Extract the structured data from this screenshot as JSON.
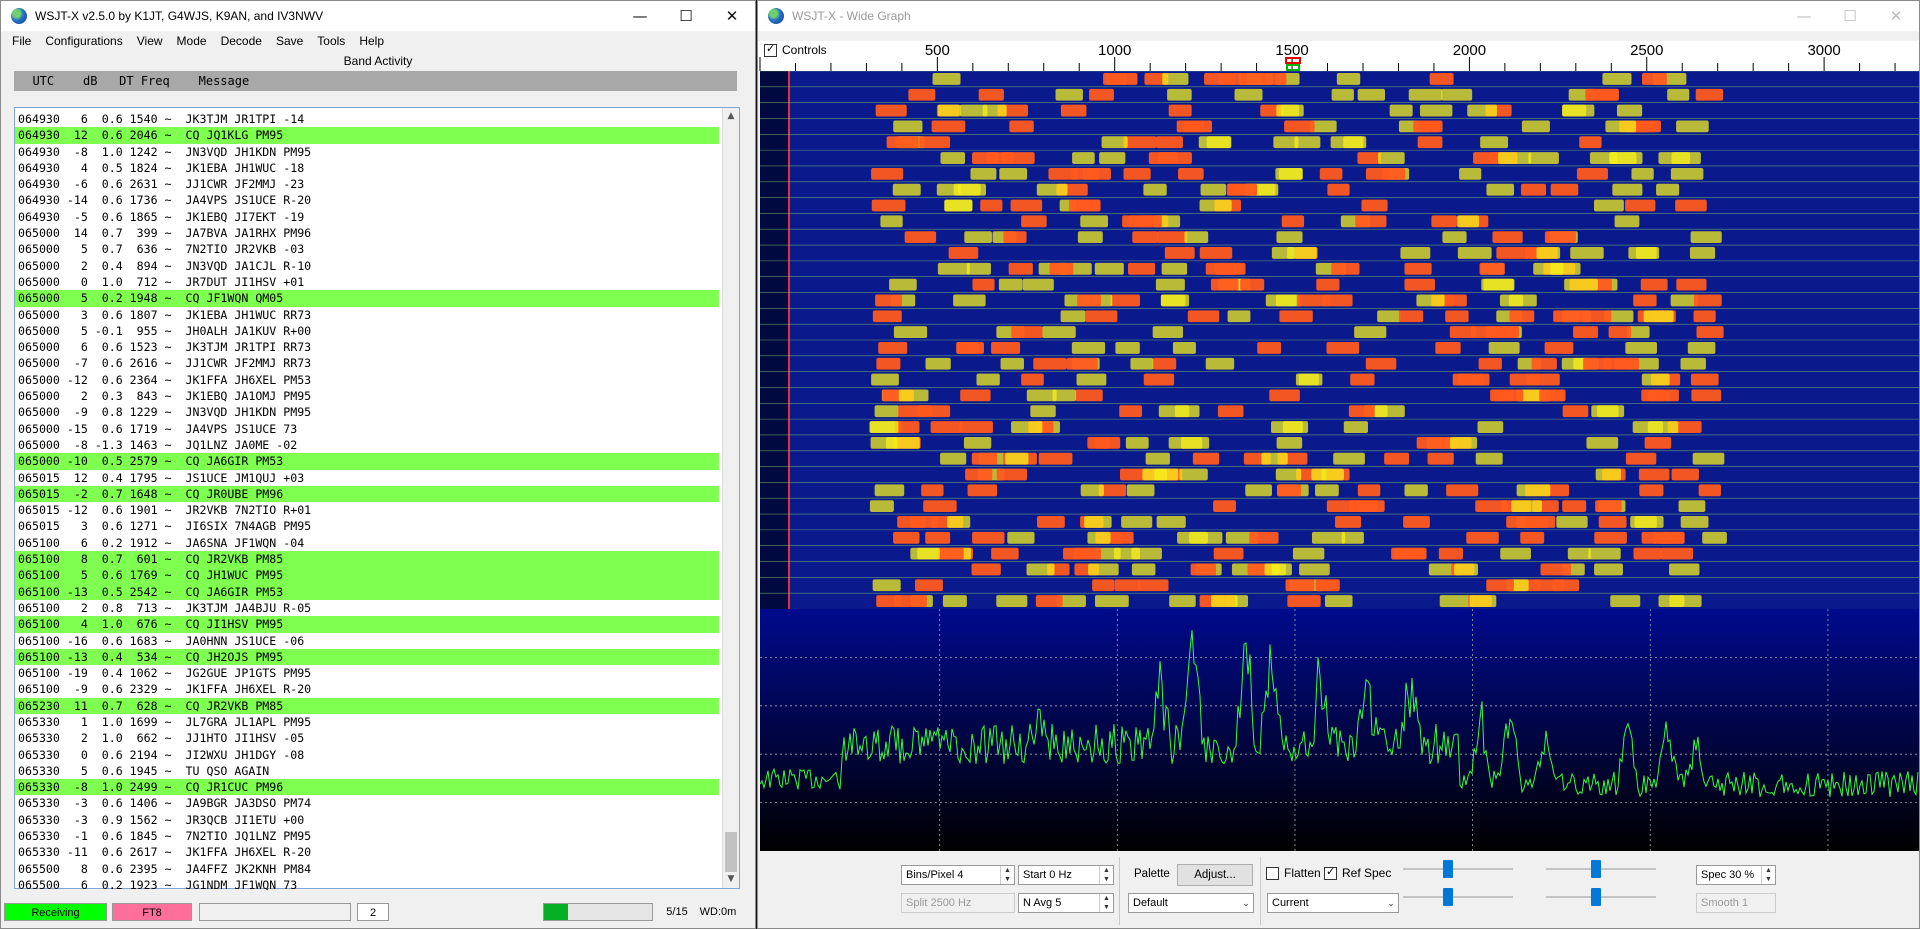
{
  "main_window": {
    "title": "WSJT-X   v2.5.0   by K1JT, G4WJS, K9AN, and IV3NWV",
    "menu": [
      "File",
      "Configurations",
      "View",
      "Mode",
      "Decode",
      "Save",
      "Tools",
      "Help"
    ],
    "band_activity_title": "Band Activity",
    "columns_header": "  UTC    dB   DT Freq    Message",
    "rows": [
      {
        "text": "064930   6  0.6 1540 ~  JK3TJM JR1TPI -14",
        "cq": false
      },
      {
        "text": "064930  12  0.6 2046 ~  CQ JQ1KLG PM95",
        "cq": true
      },
      {
        "text": "064930  -8  1.0 1242 ~  JN3VQD JH1KDN PM95",
        "cq": false
      },
      {
        "text": "064930   4  0.5 1824 ~  JK1EBA JH1WUC -18",
        "cq": false
      },
      {
        "text": "064930  -6  0.6 2631 ~  JJ1CWR JF2MMJ -23",
        "cq": false
      },
      {
        "text": "064930 -14  0.6 1736 ~  JA4VPS JS1UCE R-20",
        "cq": false
      },
      {
        "text": "064930  -5  0.6 1865 ~  JK1EBQ JI7EKT -19",
        "cq": false
      },
      {
        "text": "065000  14  0.7  399 ~  JA7BVA JA1RHX PM96",
        "cq": false
      },
      {
        "text": "065000   5  0.7  636 ~  7N2TIO JR2VKB -03",
        "cq": false
      },
      {
        "text": "065000   2  0.4  894 ~  JN3VQD JA1CJL R-10",
        "cq": false
      },
      {
        "text": "065000   0  1.0  712 ~  JR7DUT JI1HSV +01",
        "cq": false
      },
      {
        "text": "065000   5  0.2 1948 ~  CQ JF1WQN QM05",
        "cq": true
      },
      {
        "text": "065000   3  0.6 1807 ~  JK1EBA JH1WUC RR73",
        "cq": false
      },
      {
        "text": "065000   5 -0.1  955 ~  JH0ALH JA1KUV R+00",
        "cq": false
      },
      {
        "text": "065000   6  0.6 1523 ~  JK3TJM JR1TPI RR73",
        "cq": false
      },
      {
        "text": "065000  -7  0.6 2616 ~  JJ1CWR JF2MMJ RR73",
        "cq": false
      },
      {
        "text": "065000 -12  0.6 2364 ~  JK1FFA JH6XEL PM53",
        "cq": false
      },
      {
        "text": "065000   2  0.3  843 ~  JK1EBQ JA1OMJ PM95",
        "cq": false
      },
      {
        "text": "065000  -9  0.8 1229 ~  JN3VQD JH1KDN PM95",
        "cq": false
      },
      {
        "text": "065000 -15  0.6 1719 ~  JA4VPS JS1UCE 73",
        "cq": false
      },
      {
        "text": "065000  -8 -1.3 1463 ~  JQ1LNZ JA0ME -02",
        "cq": false
      },
      {
        "text": "065000 -10  0.5 2579 ~  CQ JA6GIR PM53",
        "cq": true
      },
      {
        "text": "065015  12  0.4 1795 ~  JS1UCE JM1QUJ +03",
        "cq": false
      },
      {
        "text": "065015  -2  0.7 1648 ~  CQ JR0UBE PM96",
        "cq": true
      },
      {
        "text": "065015 -12  0.6 1901 ~  JR2VKB 7N2TIO R+01",
        "cq": false
      },
      {
        "text": "065015   3  0.6 1271 ~  JI6SIX 7N4AGB PM95",
        "cq": false
      },
      {
        "text": "065100   6  0.2 1912 ~  JA6SNA JF1WQN -04",
        "cq": false
      },
      {
        "text": "065100   8  0.7  601 ~  CQ JR2VKB PM85",
        "cq": true
      },
      {
        "text": "065100   5  0.6 1769 ~  CQ JH1WUC PM95",
        "cq": true
      },
      {
        "text": "065100 -13  0.5 2542 ~  CQ JA6GIR PM53",
        "cq": true
      },
      {
        "text": "065100   2  0.8  713 ~  JK3TJM JA4BJU R-05",
        "cq": false
      },
      {
        "text": "065100   4  1.0  676 ~  CQ JI1HSV PM95",
        "cq": true
      },
      {
        "text": "065100 -16  0.6 1683 ~  JA0HNN JS1UCE -06",
        "cq": false
      },
      {
        "text": "065100 -13  0.4  534 ~  CQ JH2OJS PM95",
        "cq": true
      },
      {
        "text": "065100 -19  0.4 1062 ~  JG2GUE JP1GTS PM95",
        "cq": false
      },
      {
        "text": "065100  -9  0.6 2329 ~  JK1FFA JH6XEL R-20",
        "cq": false
      },
      {
        "text": "065230  11  0.7  628 ~  CQ JR2VKB PM85",
        "cq": true
      },
      {
        "text": "065330   1  1.0 1699 ~  JL7GRA JL1APL PM95",
        "cq": false
      },
      {
        "text": "065330   2  1.0  662 ~  JJ1HTO JI1HSV -05",
        "cq": false
      },
      {
        "text": "065330   0  0.6 2194 ~  JI2WXU JH1DGY -08",
        "cq": false
      },
      {
        "text": "065330   5  0.6 1945 ~  TU QSO AGAIN",
        "cq": false
      },
      {
        "text": "065330  -8  1.0 2499 ~  CQ JR1CUC PM96",
        "cq": true
      },
      {
        "text": "065330  -3  0.6 1406 ~  JA9BGR JA3DSO PM74",
        "cq": false
      },
      {
        "text": "065330  -3  0.9 1562 ~  JR3QCB JI1ETU +00",
        "cq": false
      },
      {
        "text": "065330  -1  0.6 1845 ~  7N2TIO JQ1LNZ PM95",
        "cq": false
      },
      {
        "text": "065330 -11  0.6 2617 ~  JK1FFA JH6XEL R-20",
        "cq": false
      },
      {
        "text": "065500   8  0.6 2395 ~  JA4FFZ JK2KNH PM84",
        "cq": false
      },
      {
        "text": "065500   6  0.2 1923 ~  JG1NDM JF1WQN 73",
        "cq": false
      }
    ],
    "status": {
      "receiving": "Receiving",
      "mode": "FT8",
      "blank": "",
      "count": "2",
      "progress_fraction": 0.22,
      "period": "5/15",
      "wd": "WD:0m"
    },
    "colors": {
      "cq_highlight": "#7fff50",
      "receiving": "#00ff00",
      "mode": "#ff6f9c",
      "progress": "#06b025"
    }
  },
  "wide_graph": {
    "title": "WSJT-X - Wide Graph",
    "controls_label": "Controls",
    "controls_checked": true,
    "scale_ticks": [
      {
        "label": "500",
        "hz": 500
      },
      {
        "label": "1000",
        "hz": 1000
      },
      {
        "label": "1500",
        "hz": 1500
      },
      {
        "label": "2000",
        "hz": 2000
      },
      {
        "label": "2500",
        "hz": 2500
      },
      {
        "label": "3000",
        "hz": 3000
      }
    ],
    "bins_pixel": "Bins/Pixel  4",
    "start": "Start  0 Hz",
    "split": "Split  2500  Hz",
    "n_avg": "N Avg  5",
    "palette_label": "Palette",
    "adjust_button": "Adjust...",
    "palette_value": "Default",
    "flatten_label": "Flatten",
    "flatten_checked": false,
    "ref_spec_label": "Ref Spec",
    "ref_spec_checked": true,
    "spectrum_mode": "Current",
    "spec_value": "Spec  30 %",
    "smooth_value": "Smooth   1",
    "slider_levels": [
      0.45,
      0.5,
      0.45,
      0.5
    ],
    "colors": {
      "waterfall_bg": "#0a1a8c",
      "signal_hot": "#ff5a1e",
      "signal_warm": "#f5f01e",
      "spectrum": "#33ff33"
    }
  }
}
